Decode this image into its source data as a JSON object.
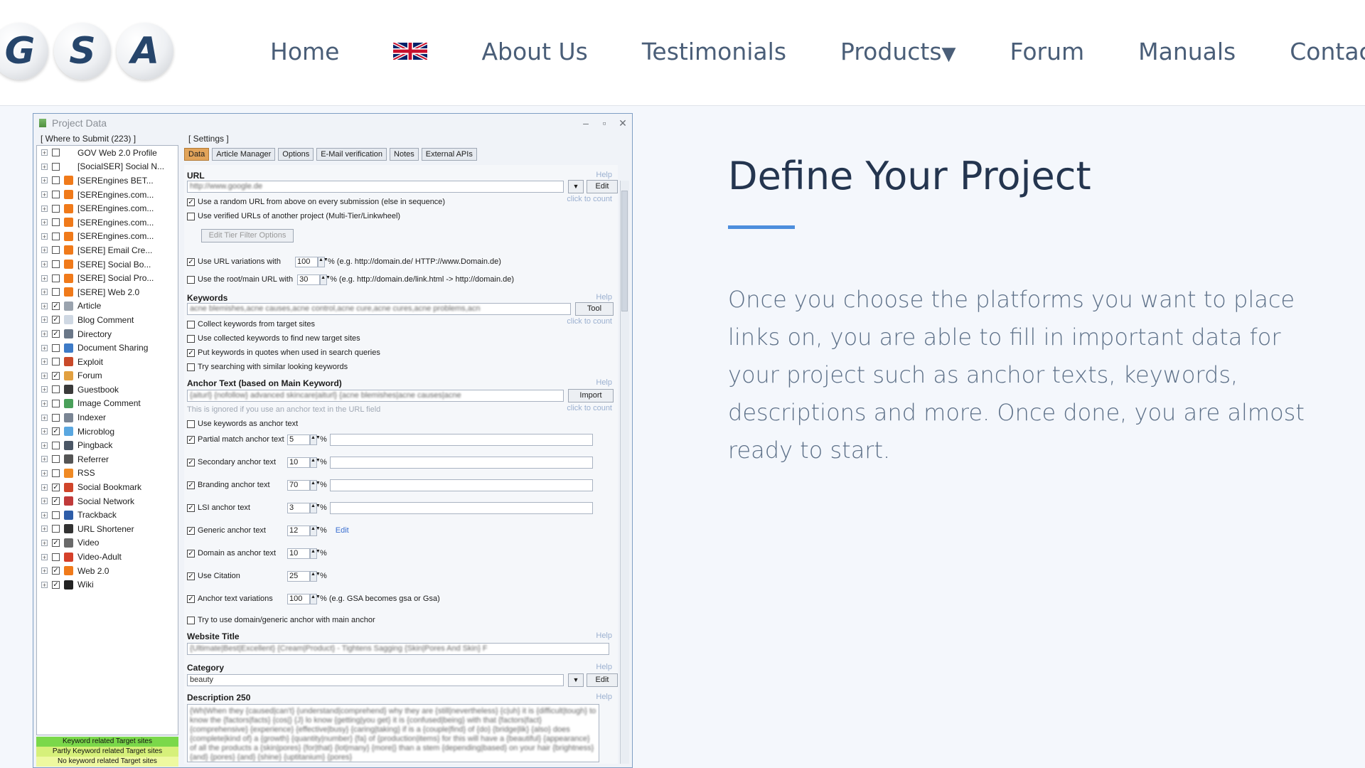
{
  "logo": {
    "letters": [
      "G",
      "S",
      "A"
    ]
  },
  "nav": {
    "items": [
      "Home",
      "About Us",
      "Testimonials",
      "Products",
      "Forum",
      "Manuals",
      "Contac"
    ],
    "products_caret": "▼"
  },
  "section": {
    "title": "Define Your Project",
    "body": "Once you choose the platforms you want to place links on, you are able to fill in important data for your project such as anchor texts, keywords, descriptions and more. Once done, you are almost ready to start.",
    "accent_color": "#4c8edd"
  },
  "window": {
    "title": "Project Data",
    "controls": [
      "–",
      "▫",
      "✕"
    ],
    "where_label": "[ Where to Submit (223) ]",
    "settings_label": "[ Settings ]",
    "tree": [
      {
        "label": "GOV Web 2.0 Profile",
        "checked": false,
        "color": "#ffffff"
      },
      {
        "label": "[SocialSER] Social N...",
        "checked": false,
        "color": "#ffffff"
      },
      {
        "label": "[SEREngines BET...",
        "checked": false,
        "color": "#f07a1a"
      },
      {
        "label": "[SEREngines.com...",
        "checked": false,
        "color": "#f07a1a"
      },
      {
        "label": "[SEREngines.com...",
        "checked": false,
        "color": "#f07a1a"
      },
      {
        "label": "[SEREngines.com...",
        "checked": false,
        "color": "#f07a1a"
      },
      {
        "label": "[SEREngines.com...",
        "checked": false,
        "color": "#f07a1a"
      },
      {
        "label": "[SERE] Email Cre...",
        "checked": false,
        "color": "#f07a1a"
      },
      {
        "label": "[SERE] Social Bo...",
        "checked": false,
        "color": "#f07a1a"
      },
      {
        "label": "[SERE] Social Pro...",
        "checked": false,
        "color": "#f07a1a"
      },
      {
        "label": "[SERE] Web 2.0",
        "checked": false,
        "color": "#f07a1a"
      },
      {
        "label": "Article",
        "checked": true,
        "color": "#9aa3ae"
      },
      {
        "label": "Blog Comment",
        "checked": true,
        "color": "#cfd8e3"
      },
      {
        "label": "Directory",
        "checked": true,
        "color": "#6a7788"
      },
      {
        "label": "Document Sharing",
        "checked": false,
        "color": "#3e7bc7"
      },
      {
        "label": "Exploit",
        "checked": false,
        "color": "#c94a2a"
      },
      {
        "label": "Forum",
        "checked": true,
        "color": "#e2a040"
      },
      {
        "label": "Guestbook",
        "checked": false,
        "color": "#3a3a3a"
      },
      {
        "label": "Image Comment",
        "checked": false,
        "color": "#4aa05a"
      },
      {
        "label": "Indexer",
        "checked": false,
        "color": "#7a8594"
      },
      {
        "label": "Microblog",
        "checked": true,
        "color": "#5aa7e0"
      },
      {
        "label": "Pingback",
        "checked": false,
        "color": "#4b5766"
      },
      {
        "label": "Referrer",
        "checked": false,
        "color": "#555555"
      },
      {
        "label": "RSS",
        "checked": false,
        "color": "#f08a24"
      },
      {
        "label": "Social Bookmark",
        "checked": true,
        "color": "#d0452a"
      },
      {
        "label": "Social Network",
        "checked": true,
        "color": "#c03a3a"
      },
      {
        "label": "Trackback",
        "checked": false,
        "color": "#2e5da8"
      },
      {
        "label": "URL Shortener",
        "checked": false,
        "color": "#333333"
      },
      {
        "label": "Video",
        "checked": true,
        "color": "#6a6a6a"
      },
      {
        "label": "Video-Adult",
        "checked": false,
        "color": "#d5402a"
      },
      {
        "label": "Web 2.0",
        "checked": true,
        "color": "#f07a1a"
      },
      {
        "label": "Wiki",
        "checked": true,
        "color": "#222222"
      }
    ],
    "legend": [
      {
        "label": "Keyword related Target sites",
        "color": "#7ad84a"
      },
      {
        "label": "Partly Keyword related Target sites",
        "color": "#d6f07a"
      },
      {
        "label": "No keyword related Target sites",
        "color": "#eef9a0"
      }
    ],
    "tabs": [
      "Data",
      "Article Manager",
      "Options",
      "E-Mail verification",
      "Notes",
      "External APIs"
    ],
    "help": "Help",
    "click_to_count": "click to count",
    "url": {
      "label": "URL",
      "value": "http://www.google.de",
      "edit": "Edit",
      "opt_random": "Use a random URL from above on every submission (else in sequence)",
      "opt_verified": "Use verified URLs of another project (Multi-Tier/Linkwheel)",
      "edit_tier": "Edit Tier Filter Options",
      "opt_variations": "Use URL variations with",
      "variations_value": "100",
      "variations_hint": "% (e.g. http://domain.de/ HTTP://www.Domain.de)",
      "opt_root": "Use the root/main URL with",
      "root_value": "30",
      "root_hint": "% (e.g. http://domain.de/link.html -> http://domain.de)"
    },
    "keywords": {
      "label": "Keywords",
      "value": "acne blemishes,acne causes,acne control,acne cure,acne cures,acne problems,acn",
      "tool": "Tool",
      "opt_collect": "Collect keywords from target sites",
      "opt_use_collected": "Use collected keywords to find new target sites",
      "opt_quotes": "Put keywords in quotes when used in search queries",
      "opt_similar": "Try searching with similar looking keywords"
    },
    "anchor": {
      "label": "Anchor Text (based on Main Keyword)",
      "value": "{aiturl} {nofollow} advanced skincare|aiturl} {acne blemishes|acne causes|acne",
      "import": "Import",
      "ignored_note": "This is ignored if you use an anchor text in the URL field",
      "opt_keywords": "Use keywords as anchor text",
      "rows": [
        {
          "label": "Partial match anchor text",
          "value": "5",
          "checked": true,
          "hint": "%"
        },
        {
          "label": "Secondary anchor text",
          "value": "10",
          "checked": true,
          "hint": "%"
        },
        {
          "label": "Branding anchor text",
          "value": "70",
          "checked": true,
          "hint": "%"
        },
        {
          "label": "LSI anchor text",
          "value": "3",
          "checked": true,
          "hint": "%"
        },
        {
          "label": "Generic anchor text",
          "value": "12",
          "checked": true,
          "hint": "%",
          "link": "Edit"
        },
        {
          "label": "Domain as anchor text",
          "value": "10",
          "checked": true,
          "hint": "%"
        },
        {
          "label": "Use Citation",
          "value": "25",
          "checked": true,
          "hint": "%"
        },
        {
          "label": "Anchor text variations",
          "value": "100",
          "checked": true,
          "hint": "% (e.g. GSA becomes gsa or Gsa)"
        }
      ],
      "opt_domain_generic": "Try to use domain/generic anchor with main anchor"
    },
    "website_title": {
      "label": "Website Title",
      "value": "{Ultimate|Best|Excellent} {Cream|Product} - Tightens Sagging {Skin|Pores And Skin} F"
    },
    "category": {
      "label": "Category",
      "value": "beauty",
      "edit": "Edit"
    },
    "description": {
      "label": "Description 250",
      "value": "{Wh|When they {caused|can't} {understand|comprehend} why they are {still|nevertheless} {c|uh} it is {difficult|tough} to know the {factors|facts} {cos|} {J} lo know {getting|you get} it is {confused|being} with that {factors|fact} {comprehensive} {experience} {effective|busy} {caring|taking} if is a {couple|find} of {do} {bridge|lik} {also} does {complete|kind of} a {growth} {quantity|number} {fa} of {production|items} for this will have a {beautiful} {appearance} of all the products a {skin|pores} {for|that} {lot|many} {more|} than a stem {depending|based} on your hair {brightness} {and} {pores} {and} {shine} {uptitanium} {pores}"
    }
  }
}
